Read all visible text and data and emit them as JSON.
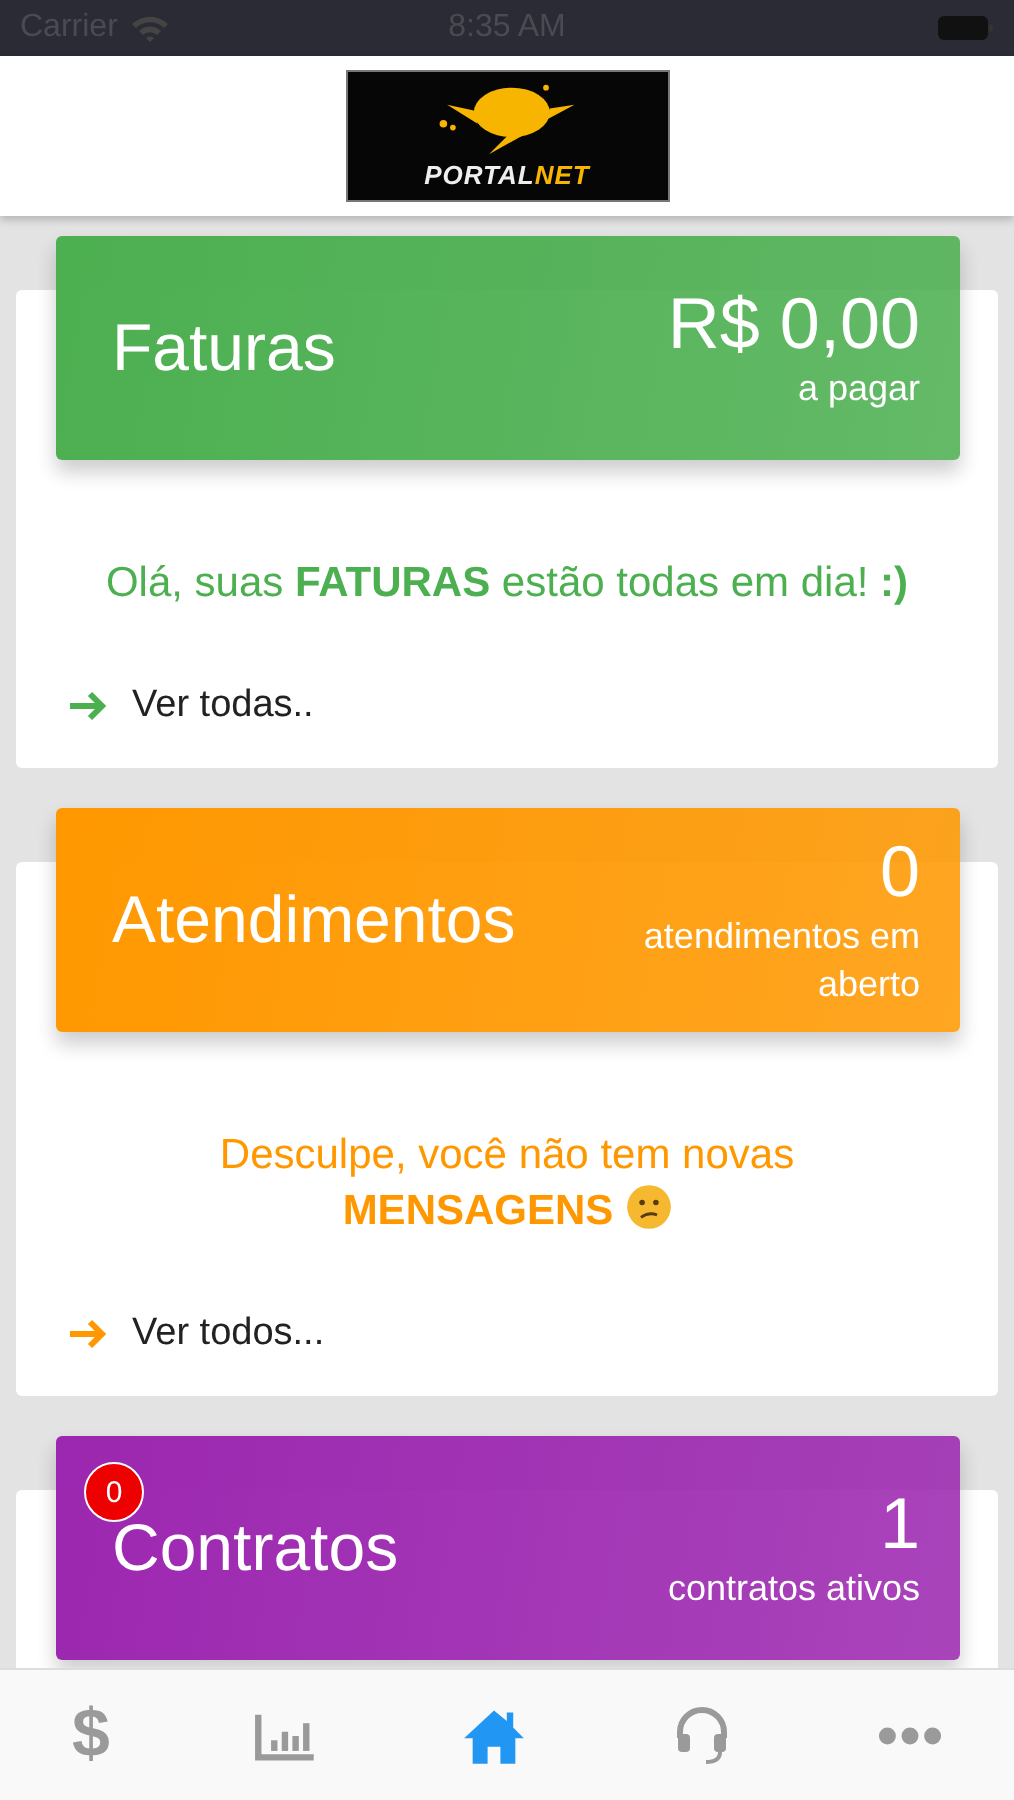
{
  "status_bar": {
    "carrier": "Carrier",
    "time": "8:35 AM"
  },
  "logo": {
    "word": "PORTAL",
    "accent": "NET"
  },
  "cards": [
    {
      "title": "Faturas",
      "value": "R$ 0,00",
      "caption": "a pagar",
      "color": "#4caf50",
      "message": "Olá, suas **FATURAS** estão todas em dia! **:)**",
      "link": "Ver todas.."
    },
    {
      "title": "Atendimentos",
      "value": "0",
      "caption": "atendimentos em aberto",
      "color": "#ff9800",
      "message": "Desculpe, você não tem novas **MENSAGENS**",
      "sad_face": true,
      "link": "Ver todos..."
    },
    {
      "title": "Contratos",
      "value": "1",
      "caption": "contratos ativos",
      "color": "#9c27b0",
      "badge": "0"
    }
  ],
  "tabs": [
    {
      "kind": "glyph",
      "text": "$",
      "selected": false
    },
    {
      "kind": "chart",
      "selected": false
    },
    {
      "kind": "home",
      "selected": true
    },
    {
      "kind": "headset",
      "selected": false
    },
    {
      "kind": "more",
      "selected": false
    }
  ]
}
